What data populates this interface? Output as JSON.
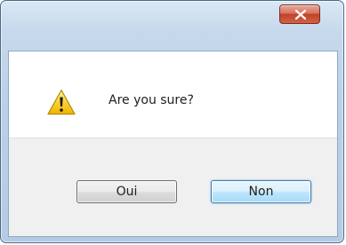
{
  "dialog": {
    "message": "Are you sure?",
    "icon": "warning-icon",
    "close_icon": "close-icon"
  },
  "buttons": {
    "oui_label": "Oui",
    "non_label": "Non"
  },
  "colors": {
    "frame": "#bcd1e8",
    "close_button": "#c2412a",
    "default_button_border": "#3c7fb1",
    "warning_yellow": "#f5c400"
  }
}
